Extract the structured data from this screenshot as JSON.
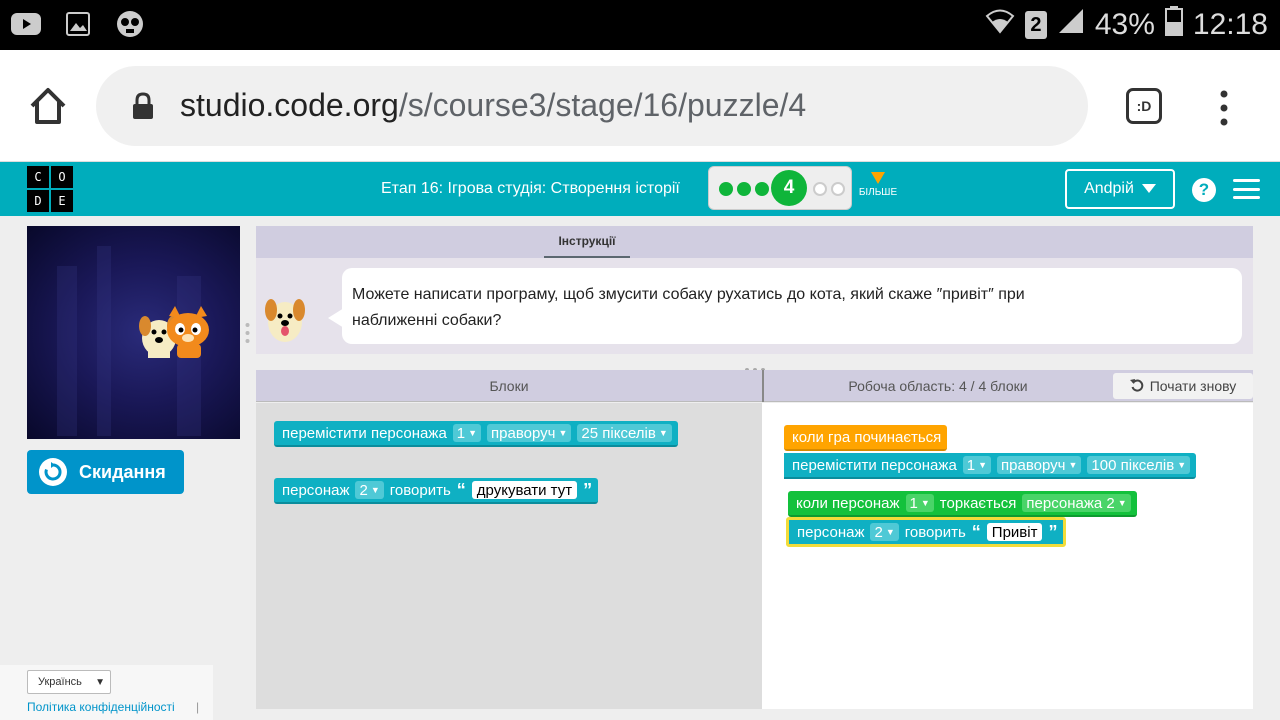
{
  "status_bar": {
    "battery": "43%",
    "time": "12:18",
    "sim": "2"
  },
  "browser": {
    "url_host": "studio.code.org",
    "url_path": "/s/course3/stage/16/puzzle/4",
    "tab_label": ":D"
  },
  "header": {
    "logo_letters": [
      "C",
      "O",
      "D",
      "E"
    ],
    "stage_title": "Етап 16: Ігрова студія: Створення історії",
    "current_puzzle": "4",
    "more_label": "БІЛЬШЕ",
    "user_name": "Andрій"
  },
  "game": {
    "reset_label": "Скидання"
  },
  "instructions": {
    "tab_label": "Інструкції",
    "text_line1": "Можете написати програму, щоб змусити собаку рухатись до кота, який скаже ″привіт″ при",
    "text_line2": "наближенні собаки?"
  },
  "workspace_header": {
    "blocks_label": "Блоки",
    "work_label": "Робоча область: 4 / 4 блоки",
    "restart_label": "Почати знову"
  },
  "toolbox": {
    "move_block": {
      "label": "перемістити персонажа",
      "sprite": "1",
      "direction": "праворуч",
      "distance": "25 пікселів"
    },
    "say_block": {
      "label": "персонаж",
      "sprite": "2",
      "say": "говорить",
      "text": "друкувати тут"
    }
  },
  "workspace": {
    "when_run": "коли гра починається",
    "move_block": {
      "label": "перемістити персонажа",
      "sprite": "1",
      "direction": "праворуч",
      "distance": "100 пікселів"
    },
    "collide_block": {
      "label": "коли персонаж",
      "sprite": "1",
      "touches": "торкається",
      "target": "персонажа 2"
    },
    "say_block": {
      "label": "персонаж",
      "sprite": "2",
      "say": "говорить",
      "text": "Привіт"
    }
  },
  "footer": {
    "language": "Українсь",
    "privacy": "Політика конфіденційності",
    "separator": "|"
  },
  "colors": {
    "header": "#00adbc",
    "block_teal": "#0fb0c3",
    "block_orange": "#ffa400",
    "block_green": "#13c13c",
    "button_blue": "#0094ca",
    "progress_green": "#0fb53a"
  }
}
